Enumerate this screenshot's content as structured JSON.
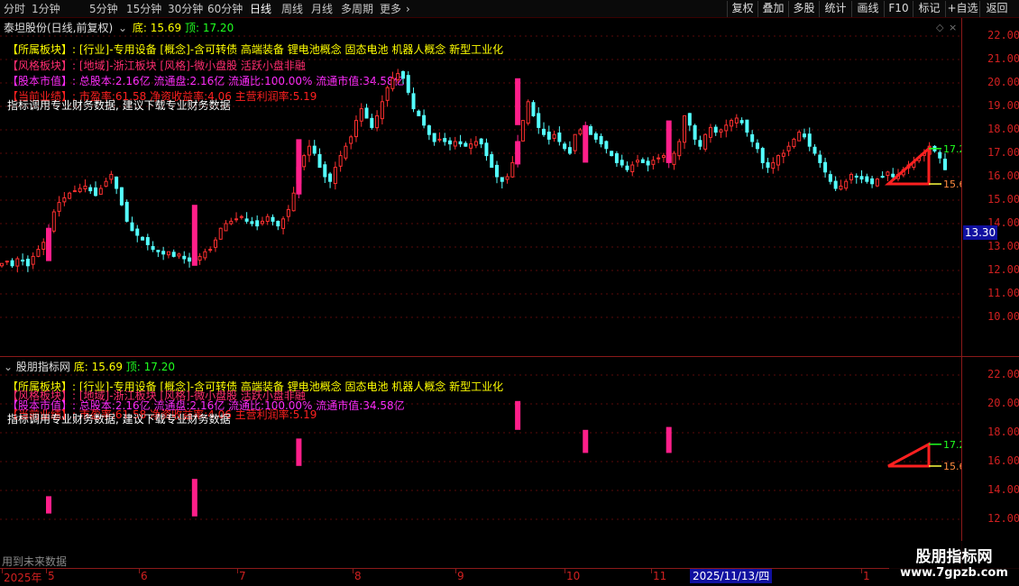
{
  "toolbar": {
    "timeframes": [
      "分时",
      "1分钟",
      "5分钟",
      "15分钟",
      "30分钟",
      "60分钟",
      "日线",
      "周线",
      "月线",
      "多周期",
      "更多"
    ],
    "active": "日线",
    "right_buttons": [
      "复权",
      "叠加",
      "多股",
      "统计",
      "画线",
      "F10",
      "标记",
      "+自选",
      "返回"
    ]
  },
  "main_panel": {
    "title": "泰坦股份(日线,前复权)",
    "low_label": "底:",
    "low_value": "15.69",
    "high_label": "顶:",
    "high_value": "17.20",
    "price_badge": "13.30",
    "y_ticks": [
      "22.00",
      "21.00",
      "20.00",
      "19.00",
      "18.00",
      "17.00",
      "16.00",
      "15.00",
      "14.00",
      "13.00",
      "12.00",
      "11.00",
      "10.00"
    ],
    "annot_high": "17.2",
    "annot_low": "15.6"
  },
  "info_lines": {
    "sector_label": "【所属板块】:",
    "sector_value": "[行业]-专用设备 [概念]-含可转债 高端装备 锂电池概念 固态电池 机器人概念 新型工业化",
    "style_label": "【风格板块】:",
    "style_value": "[地域]-浙江板块 [风格]-微小盘股 活跃小盘非融",
    "cap_label": "【股本市值】:",
    "cap_value": "总股本:2.16亿 流通盘:2.16亿 流通比:100.00% 流通市值:34.58亿",
    "perf_label": "【当前业绩】:",
    "perf_value": "市盈率:61.58 净资收益率:4.06 主营利润率:5.19",
    "notice": "指标调用专业财务数据, 建议下载专业财务数据"
  },
  "indicator_panel": {
    "title": "股朋指标网",
    "low_label": "底:",
    "low_value": "15.69",
    "high_label": "顶:",
    "high_value": "17.20",
    "y_ticks": [
      "22.00",
      "20.00",
      "18.00",
      "16.00",
      "14.00",
      "12.00"
    ],
    "annot_high": "17.2",
    "annot_low": "15.6",
    "future_note": "用到未来数据"
  },
  "x_axis": {
    "labels": [
      "2025年",
      "5",
      "6",
      "7",
      "8",
      "9",
      "10",
      "11",
      "1"
    ],
    "cursor_date": "2025/11/13/四"
  },
  "watermark": {
    "title": "股朋指标网",
    "url": "www.7gpzb.com"
  },
  "colors": {
    "up": "#ff3030",
    "down": "#54ffff",
    "signal": "#ff1f8a",
    "axis": "#8b1a1a",
    "badge_bg": "#1010a0"
  },
  "chart_data": {
    "type": "candlestick",
    "low_line": 15.69,
    "high_line": 17.2,
    "closes": [
      12.3,
      12.4,
      12.2,
      12.5,
      12.4,
      12.2,
      12.6,
      12.9,
      13.2,
      13.8,
      14.5,
      14.9,
      15.1,
      15.3,
      15.4,
      15.5,
      15.6,
      15.4,
      15.2,
      15.5,
      15.8,
      16.1,
      15.5,
      14.8,
      14.1,
      13.7,
      13.5,
      13.3,
      13.1,
      12.9,
      12.8,
      12.7,
      12.8,
      12.6,
      12.7,
      12.5,
      12.4,
      12.5,
      12.6,
      12.8,
      12.9,
      13.3,
      13.8,
      14.0,
      14.1,
      14.2,
      14.3,
      14.1,
      14.0,
      13.9,
      14.1,
      14.3,
      14.1,
      13.9,
      14.2,
      14.6,
      15.3,
      16.4,
      16.9,
      17.3,
      17.0,
      16.4,
      16.0,
      15.8,
      16.4,
      16.9,
      17.3,
      17.7,
      18.4,
      18.9,
      18.5,
      18.1,
      18.6,
      19.2,
      19.8,
      20.2,
      20.4,
      20.2,
      19.6,
      18.9,
      18.6,
      18.2,
      17.8,
      17.5,
      17.6,
      17.5,
      17.4,
      17.5,
      17.4,
      17.3,
      17.4,
      17.5,
      17.4,
      16.9,
      16.4,
      16.0,
      15.8,
      16.0,
      16.6,
      17.5,
      18.4,
      19.2,
      18.6,
      18.1,
      17.8,
      17.6,
      17.8,
      17.5,
      17.2,
      17.0,
      17.8,
      18.0,
      18.1,
      17.8,
      17.6,
      17.4,
      17.2,
      16.9,
      16.6,
      16.5,
      16.3,
      16.5,
      16.7,
      16.6,
      16.5,
      16.7,
      16.8,
      16.9,
      16.6,
      17.0,
      17.5,
      18.6,
      18.2,
      17.6,
      17.3,
      17.8,
      18.1,
      17.9,
      18.0,
      18.2,
      18.4,
      18.5,
      18.3,
      17.9,
      17.5,
      17.2,
      16.6,
      16.4,
      16.6,
      16.9,
      17.0,
      17.3,
      17.6,
      17.9,
      17.7,
      17.3,
      17.0,
      16.6,
      16.2,
      15.8,
      15.5,
      15.6,
      15.8,
      16.1,
      16.0,
      15.9,
      15.8,
      15.7,
      15.9,
      16.0,
      16.2,
      16.0,
      16.1,
      16.3,
      16.5,
      16.6,
      16.8,
      17.0,
      17.3,
      17.1,
      16.8,
      16.3
    ],
    "signals": [
      {
        "index": 9,
        "low": 12.4,
        "high": 13.6
      },
      {
        "index": 37,
        "low": 12.2,
        "high": 14.8
      },
      {
        "index": 57,
        "low": 15.7,
        "high": 17.6
      },
      {
        "index": 99,
        "low": 18.2,
        "high": 20.2
      },
      {
        "index": 112,
        "low": 16.6,
        "high": 18.2
      },
      {
        "index": 128,
        "low": 16.6,
        "high": 18.4
      }
    ],
    "x_label_positions": [
      "2025年",
      "5",
      "6",
      "7",
      "8",
      "9",
      "10",
      "11",
      "1"
    ]
  }
}
